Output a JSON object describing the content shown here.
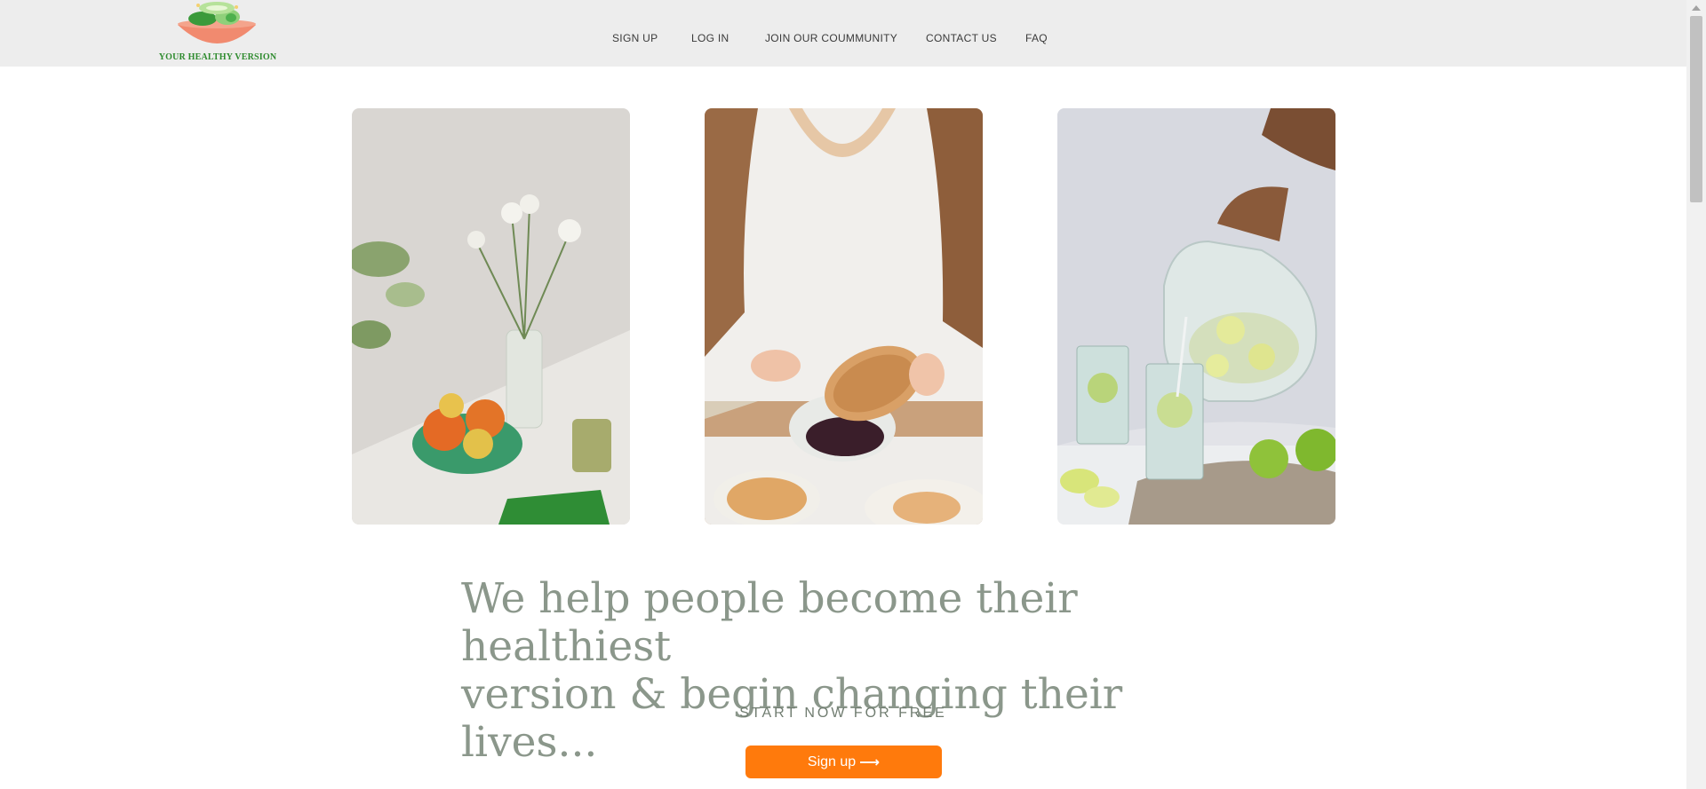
{
  "brand": {
    "logo_text": "YOUR HEALTHY VERSION",
    "logo_icon": "salad-bowl-logo",
    "colors": {
      "accent_green": "#2e8b2e",
      "bowl": "#f18a6f"
    }
  },
  "nav": {
    "items": [
      {
        "label": "SIGN UP"
      },
      {
        "label": "LOG IN"
      },
      {
        "label": "JOIN OUR COUMMUNITY"
      },
      {
        "label": "CONTACT US"
      },
      {
        "label": "FAQ"
      }
    ],
    "background": "#ededed"
  },
  "gallery": {
    "images": [
      {
        "subject": "flowers-and-fruit-bowl-photo"
      },
      {
        "subject": "peanut-butter-toast-photo"
      },
      {
        "subject": "lemon-water-pitcher-photo"
      }
    ]
  },
  "hero": {
    "headline_line1": "We help people become their healthiest",
    "headline_line2": "version & begin changing their lives...",
    "subhead": "START NOW FOR FREE",
    "cta_label": "Sign up",
    "cta_icon": "arrow-right-icon",
    "cta_color": "#ff7a0c",
    "headline_color": "#8b978b"
  }
}
